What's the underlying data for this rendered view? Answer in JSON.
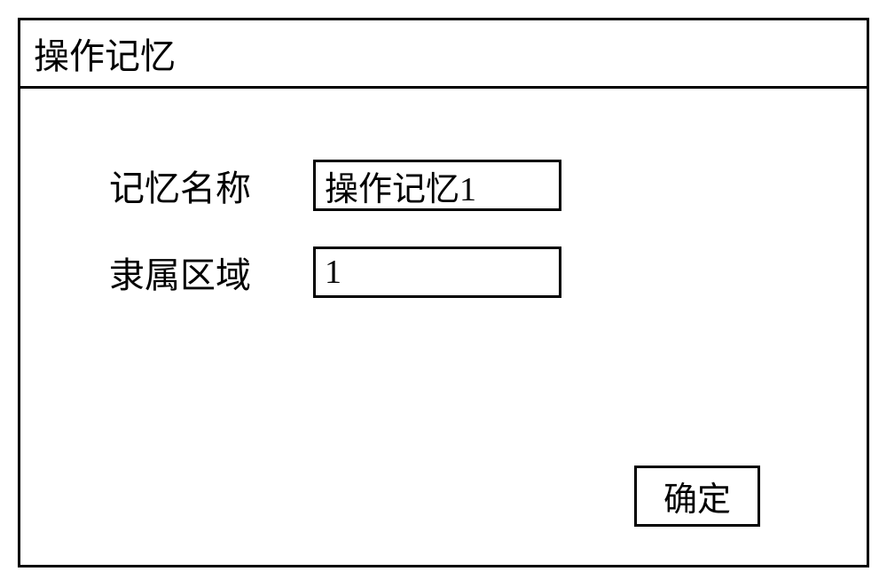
{
  "window": {
    "title": "操作记忆"
  },
  "form": {
    "memory_name": {
      "label": "记忆名称",
      "value": "操作记忆1"
    },
    "belong_area": {
      "label": "隶属区域",
      "value": "1"
    }
  },
  "buttons": {
    "confirm_label": "确定"
  }
}
